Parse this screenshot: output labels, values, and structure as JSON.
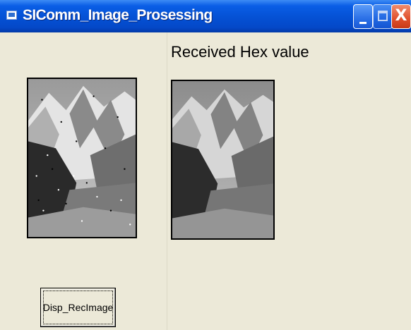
{
  "window": {
    "title": "SIComm_Image_Prosessing",
    "controls": {
      "minimize": "minimize-icon",
      "maximize": "maximize-icon",
      "close": "close-icon",
      "close_glyph": "X"
    }
  },
  "form": {
    "caption": "Received Hex value",
    "button_label": "Disp_RecImage"
  },
  "colors": {
    "titlebar": "#0552d6",
    "form_background": "#ece9d8"
  }
}
